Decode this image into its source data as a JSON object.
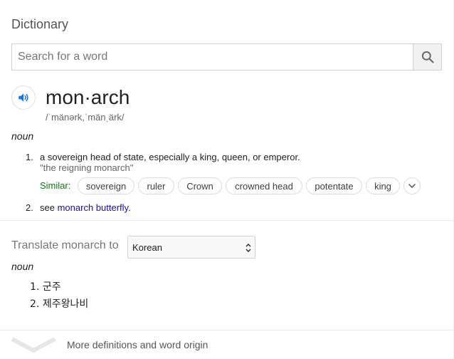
{
  "card_title": "Dictionary",
  "search": {
    "placeholder": "Search for a word",
    "value": "",
    "button_icon": "search-icon"
  },
  "entry": {
    "speaker_icon": "speaker-icon",
    "headword": "mon·arch",
    "pronunciation": "/ˈmänərk,ˈmänˌärk/",
    "part_of_speech": "noun",
    "definitions": [
      {
        "number": "1.",
        "text": "a sovereign head of state, especially a king, queen, or emperor.",
        "example": "\"the reigning monarch\"",
        "similar_label": "Similar:",
        "similar": [
          "sovereign",
          "ruler",
          "Crown",
          "crowned head",
          "potentate",
          "king"
        ],
        "more_icon": "chevron-down-icon"
      },
      {
        "number": "2.",
        "prefix": "see",
        "link": "monarch butterfly",
        "suffix": "."
      }
    ]
  },
  "translate": {
    "label": "Translate monarch to",
    "language": "Korean",
    "part_of_speech": "noun",
    "items": [
      {
        "number": "1.",
        "text": "군주"
      },
      {
        "number": "2.",
        "text": "제주왕나비"
      }
    ]
  },
  "more": {
    "label": "More definitions and word origin",
    "icon": "chevron-down-icon"
  },
  "colors": {
    "similar_label": "#0e7a1a",
    "link": "#1a0dab",
    "speaker": "#1a73e8"
  }
}
